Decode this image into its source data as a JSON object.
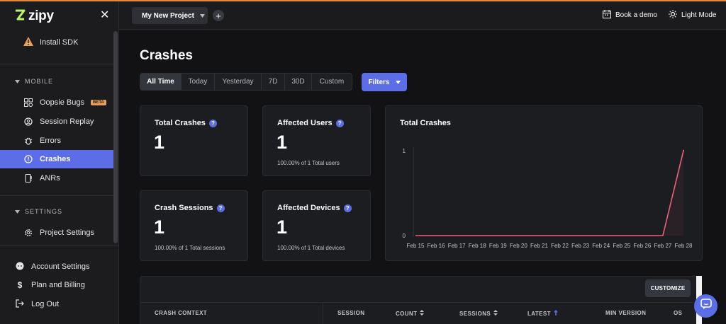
{
  "app": {
    "name": "zipy"
  },
  "sidebar": {
    "install_sdk": "Install SDK",
    "sections": [
      {
        "label": "MOBILE",
        "items": [
          {
            "label": "Oopsie Bugs",
            "badge": "BETA",
            "icon": "bug-grid-icon"
          },
          {
            "label": "Session Replay",
            "icon": "replay-icon"
          },
          {
            "label": "Errors",
            "icon": "bug-icon"
          },
          {
            "label": "Crashes",
            "icon": "alert-circle-icon",
            "active": true
          },
          {
            "label": "ANRs",
            "icon": "phone-alert-icon"
          }
        ]
      },
      {
        "label": "SETTINGS",
        "items": [
          {
            "label": "Project Settings",
            "icon": "gear-icon"
          }
        ]
      }
    ],
    "bottom": [
      {
        "label": "Account Settings",
        "icon": "account-icon"
      },
      {
        "label": "Plan and Billing",
        "icon": "dollar-icon"
      },
      {
        "label": "Log Out",
        "icon": "logout-icon"
      }
    ]
  },
  "topbar": {
    "project": "My New Project",
    "book_demo": "Book a demo",
    "light_mode": "Light Mode"
  },
  "main": {
    "title": "Crashes",
    "time_ranges": [
      "All Time",
      "Today",
      "Yesterday",
      "7D",
      "30D",
      "Custom"
    ],
    "active_range": "All Time",
    "filters_label": "Filters",
    "stats": [
      {
        "title": "Total Crashes",
        "value": "1",
        "sub": ""
      },
      {
        "title": "Affected Users",
        "value": "1",
        "sub": "100.00% of 1 Total users"
      },
      {
        "title": "Crash Sessions",
        "value": "1",
        "sub": "100.00% of 1 Total sessions"
      },
      {
        "title": "Affected Devices",
        "value": "1",
        "sub": "100.00% of 1 Total devices"
      }
    ],
    "customize_label": "CUSTOMIZE",
    "table_headers": [
      "CRASH CONTEXT",
      "SESSION",
      "COUNT",
      "SESSIONS",
      "LATEST",
      "MIN VERSION",
      "OS"
    ]
  },
  "colors": {
    "accent": "#5b6ee8",
    "line": "#e8627a",
    "badge": "#e7a15a"
  },
  "chart_data": {
    "type": "line",
    "title": "Total Crashes",
    "categories": [
      "Feb 15",
      "Feb 16",
      "Feb 17",
      "Feb 18",
      "Feb 19",
      "Feb 20",
      "Feb 21",
      "Feb 22",
      "Feb 23",
      "Feb 24",
      "Feb 25",
      "Feb 26",
      "Feb 27",
      "Feb 28"
    ],
    "values": [
      0,
      0,
      0,
      0,
      0,
      0,
      0,
      0,
      0,
      0,
      0,
      0,
      0,
      1
    ],
    "y_ticks": [
      "0",
      "1"
    ],
    "ylim": [
      0,
      1
    ],
    "grid": false
  }
}
